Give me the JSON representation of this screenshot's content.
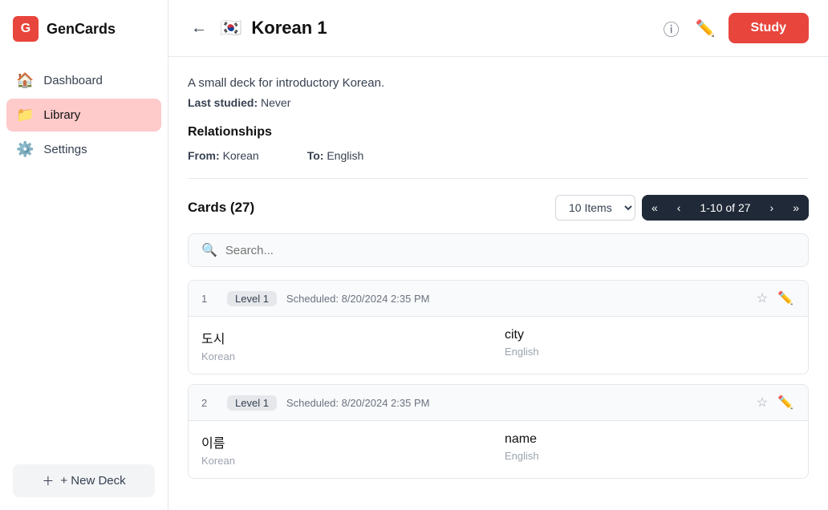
{
  "app": {
    "name": "GenCards",
    "logo_char": "G"
  },
  "sidebar": {
    "nav_items": [
      {
        "id": "dashboard",
        "label": "Dashboard",
        "icon": "🏠",
        "active": false
      },
      {
        "id": "library",
        "label": "Library",
        "icon": "📁",
        "active": true
      },
      {
        "id": "settings",
        "label": "Settings",
        "icon": "⚙️",
        "active": false
      }
    ],
    "new_deck_label": "+ New Deck"
  },
  "header": {
    "deck_emoji": "🇰🇷",
    "deck_title": "Korean 1",
    "study_label": "Study"
  },
  "deck": {
    "description": "A small deck for introductory Korean.",
    "last_studied_label": "Last studied:",
    "last_studied_value": "Never",
    "relationships_label": "Relationships",
    "from_label": "From:",
    "from_value": "Korean",
    "to_label": "To:",
    "to_value": "English"
  },
  "cards_section": {
    "title": "Cards (27)",
    "items_value": "10 Items",
    "pagination": {
      "range": "1-10 of 27"
    },
    "search_placeholder": "Search..."
  },
  "cards": [
    {
      "num": "1",
      "level": "Level 1",
      "scheduled": "Scheduled: 8/20/2024 2:35 PM",
      "front_word": "도시",
      "front_lang": "Korean",
      "back_word": "city",
      "back_lang": "English"
    },
    {
      "num": "2",
      "level": "Level 1",
      "scheduled": "Scheduled: 8/20/2024 2:35 PM",
      "front_word": "이름",
      "front_lang": "Korean",
      "back_word": "name",
      "back_lang": "English"
    }
  ]
}
